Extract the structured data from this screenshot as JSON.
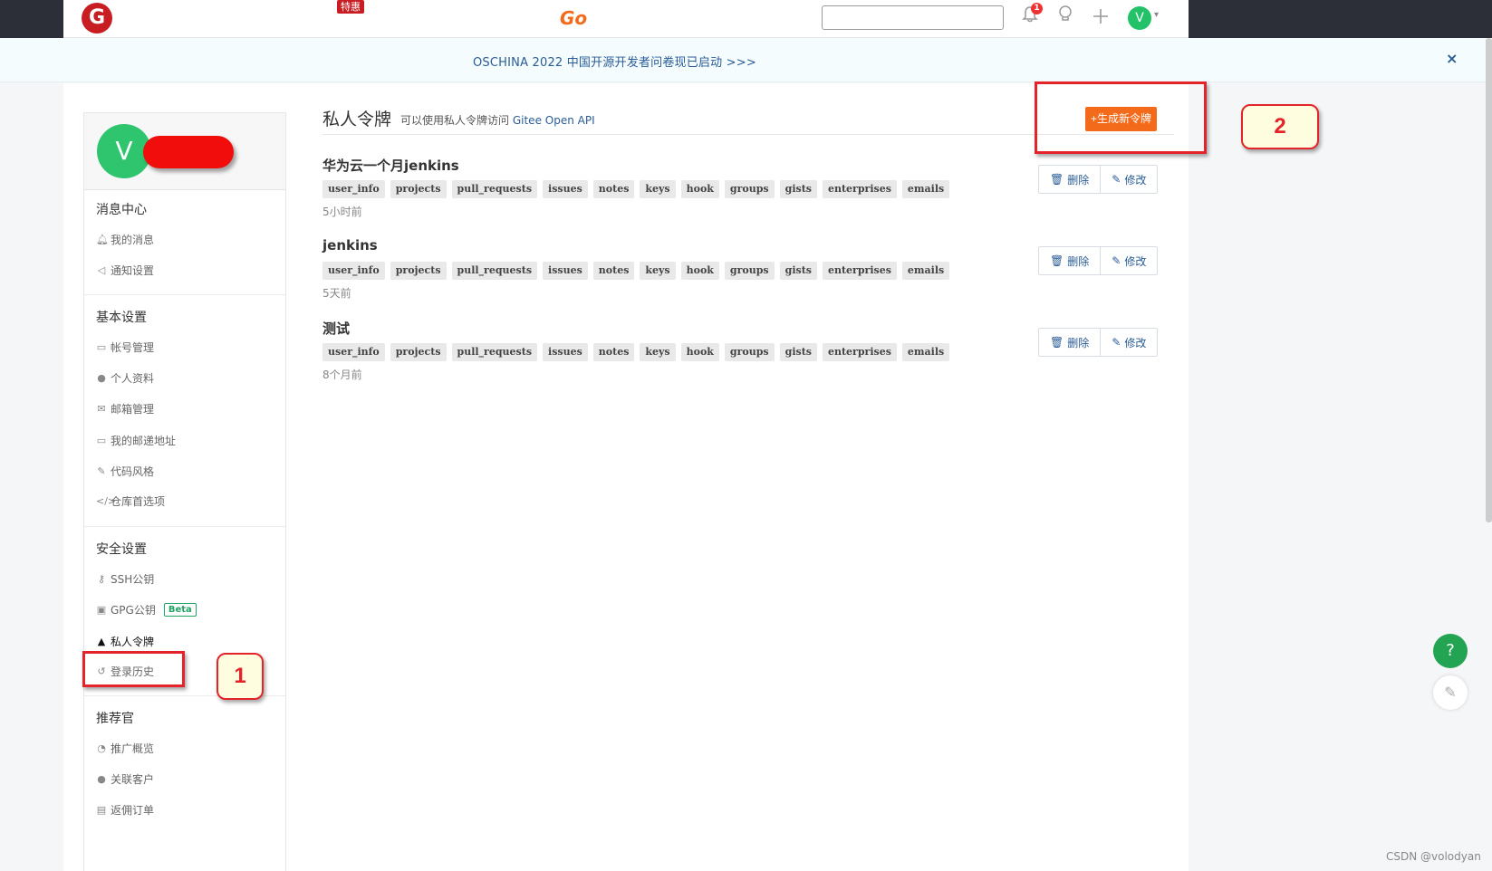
{
  "topbar": {
    "logo": "G",
    "promo_badge": "特惠",
    "go_logo": "Go",
    "search_placeholder": "",
    "notification_count": "1",
    "avatar_letter": "V"
  },
  "notice": {
    "text": "OSCHINA 2022 中国开源开发者问卷现已启动 >>>",
    "close": "×"
  },
  "sidebar": {
    "avatar_letter": "V",
    "groups": [
      {
        "title": "消息中心",
        "items": [
          "我的消息",
          "通知设置"
        ]
      },
      {
        "title": "基本设置",
        "items": [
          "帐号管理",
          "个人资料",
          "邮箱管理",
          "我的邮递地址",
          "代码风格",
          "仓库首选项"
        ]
      },
      {
        "title": "安全设置",
        "items": [
          "SSH公钥",
          "GPG公钥",
          "私人令牌",
          "登录历史"
        ]
      },
      {
        "title": "推荐官",
        "items": [
          "推广概览",
          "关联客户",
          "返佣订单"
        ]
      }
    ],
    "beta_badge": "Beta"
  },
  "main": {
    "title": "私人令牌",
    "subtitle": "可以使用私人令牌访问",
    "subtitle_link": "Gitee Open API",
    "generate_button": "+生成新令牌",
    "delete_label": "删除",
    "edit_label": "修改",
    "tokens": [
      {
        "name": "华为云一个月jenkins",
        "scopes": [
          "user_info",
          "projects",
          "pull_requests",
          "issues",
          "notes",
          "keys",
          "hook",
          "groups",
          "gists",
          "enterprises",
          "emails"
        ],
        "time": "5小时前"
      },
      {
        "name": "jenkins",
        "scopes": [
          "user_info",
          "projects",
          "pull_requests",
          "issues",
          "notes",
          "keys",
          "hook",
          "groups",
          "gists",
          "enterprises",
          "emails"
        ],
        "time": "5天前"
      },
      {
        "name": "测试",
        "scopes": [
          "user_info",
          "projects",
          "pull_requests",
          "issues",
          "notes",
          "keys",
          "hook",
          "groups",
          "gists",
          "enterprises",
          "emails"
        ],
        "time": "8个月前"
      }
    ]
  },
  "annotations": {
    "label_1": "1",
    "label_2": "2"
  },
  "floating": {
    "help": "?"
  },
  "watermark": "CSDN @volodyan",
  "colors": {
    "accent": "#f36b1a",
    "brand": "#c71d23",
    "link": "#2a5c96",
    "annotation": "#e3242b"
  }
}
